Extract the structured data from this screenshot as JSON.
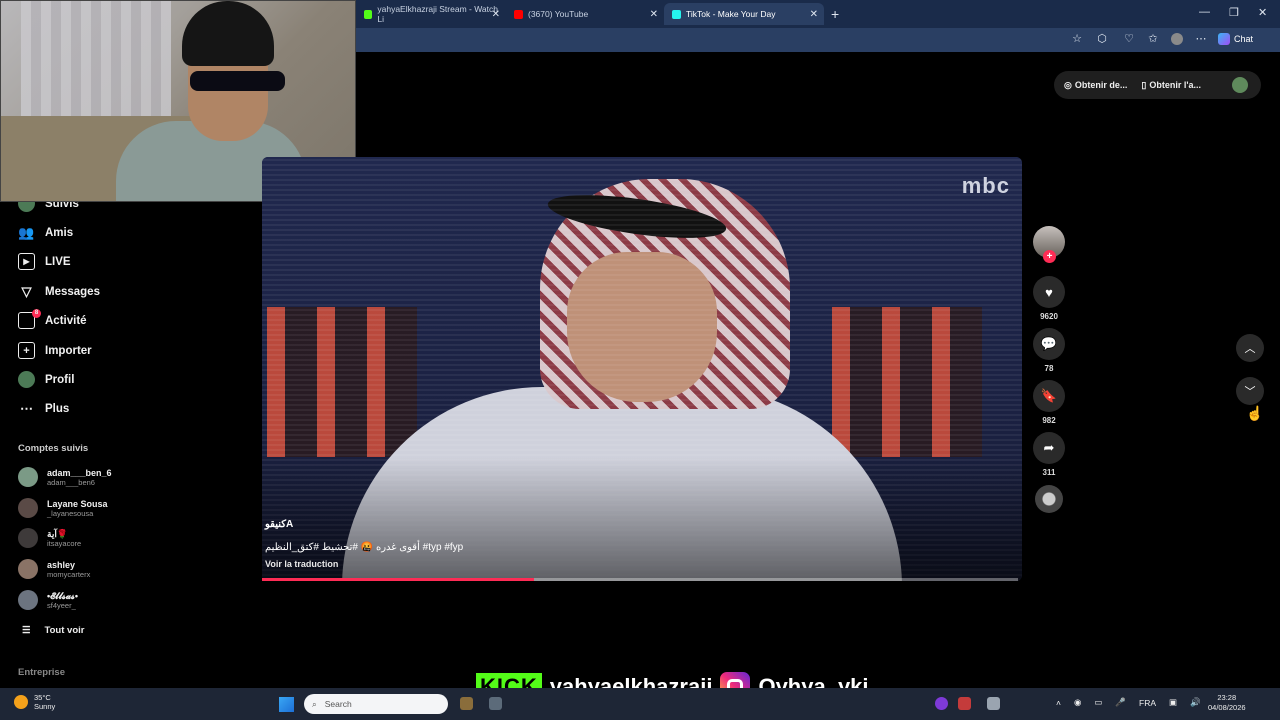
{
  "browser": {
    "tabs": [
      {
        "label": "yahyaElkhazraji Stream - Watch Li",
        "color": "#53fc18"
      },
      {
        "label": "(3670) YouTube",
        "color": "#ff0000"
      },
      {
        "label": "TikTok - Make Your Day",
        "color": "#25f4ee",
        "active": true
      }
    ],
    "chat_label": "Chat"
  },
  "sidebar": {
    "nav": [
      {
        "label": "Suivis",
        "icon": "following-icon"
      },
      {
        "label": "Amis",
        "icon": "friends-icon"
      },
      {
        "label": "LIVE",
        "icon": "live-icon"
      },
      {
        "label": "Messages",
        "icon": "messages-icon"
      },
      {
        "label": "Activité",
        "icon": "activity-icon",
        "badge": "8"
      },
      {
        "label": "Importer",
        "icon": "upload-icon"
      },
      {
        "label": "Profil",
        "icon": "profile-icon"
      },
      {
        "label": "Plus",
        "icon": "more-icon"
      }
    ],
    "following_title": "Comptes suivis",
    "accounts": [
      {
        "name": "adam___ben_6",
        "handle": "adam___ben6",
        "color": "#7b9a86"
      },
      {
        "name": "Layane Sousa",
        "handle": "_layanesousa",
        "color": "#5a4a46"
      },
      {
        "name": "آية🌹",
        "handle": "itsayacore",
        "color": "#3e3a3a"
      },
      {
        "name": "ashley",
        "handle": "momycarterx",
        "color": "#8a7366"
      },
      {
        "name": "•𝓔𝓵𝓵𝓼𝓪𝓼•",
        "handle": "sf4yeer_",
        "color": "#6c7480"
      }
    ],
    "see_all": "Tout voir",
    "company": "Entreprise"
  },
  "top_actions": {
    "get_coins": "Obtenir de...",
    "get_app": "Obtenir l'a..."
  },
  "video": {
    "channel_logo": "mbc",
    "author": "كنيقوA",
    "caption": "أقوى غدره 🤬 #تحشيط #كتق_النظيم #typ #fyp",
    "translate": "Voir la traduction",
    "progress": 0.36
  },
  "actions": {
    "likes": "9620",
    "comments": "78",
    "saves": "982",
    "shares": "311"
  },
  "overlay": {
    "kick_logo": "KICK",
    "kick_handle": "yahyaelkhazraji",
    "ig_handle": "Oyhya_ykj"
  },
  "taskbar": {
    "temperature": "35°C",
    "weather": "Sunny",
    "search_placeholder": "Search",
    "lang": "FRA",
    "time": "23:28",
    "date": "04/08/2026"
  }
}
